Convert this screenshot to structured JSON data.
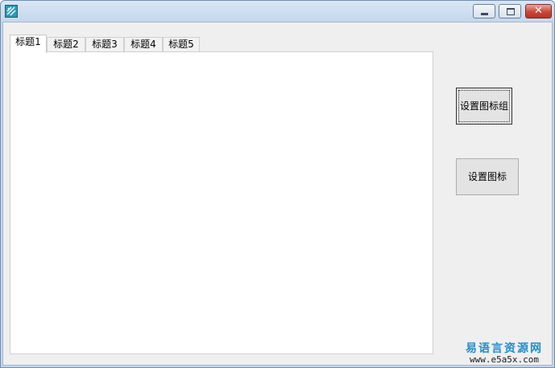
{
  "window": {
    "title": "",
    "icon": "app-icon",
    "caption_buttons": [
      {
        "name": "minimize",
        "icon": "minimize-icon"
      },
      {
        "name": "maximize",
        "icon": "maximize-icon"
      },
      {
        "name": "close",
        "icon": "close-icon",
        "glyph": "✕"
      }
    ]
  },
  "tabs": [
    {
      "label": "标题1",
      "active": true
    },
    {
      "label": "标题2",
      "active": false
    },
    {
      "label": "标题3",
      "active": false
    },
    {
      "label": "标题4",
      "active": false
    },
    {
      "label": "标题5",
      "active": false
    }
  ],
  "buttons": {
    "set_icon_group": "设置图标组",
    "set_icon": "设置图标"
  },
  "watermark": {
    "title": "易语言资源网",
    "url": "www.e5a5x.com"
  },
  "colors": {
    "window_border": "#6f8fb3",
    "client_bg": "#efefef",
    "watermark": "#1e8ecf",
    "close_button": "#c8473a"
  }
}
